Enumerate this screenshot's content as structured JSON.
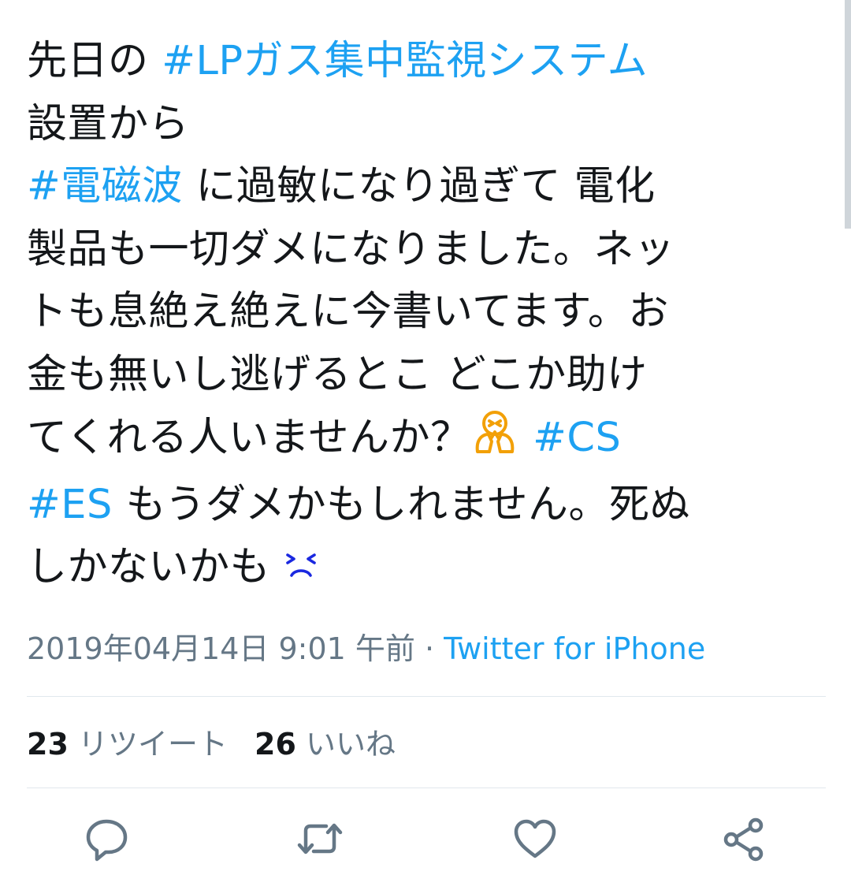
{
  "tweet": {
    "lines": [
      [
        {
          "t": "先日の "
        },
        {
          "t": "#LPガス集中監視システム",
          "tag": true
        }
      ],
      [
        {
          "t": "設置から"
        }
      ],
      [
        {
          "t": "#電磁波",
          "tag": true
        },
        {
          "t": " に過敏になり過ぎて 電化"
        }
      ],
      [
        {
          "t": "製品も一切ダメになりました。ネッ"
        }
      ],
      [
        {
          "t": "トも息絶え絶えに今書いてます。お"
        }
      ],
      [
        {
          "t": "金も無いし逃げるとこ どこか助け"
        }
      ],
      [
        {
          "t": "てくれる人いませんか？"
        },
        {
          "emoji": "face-in-hands-emoji"
        },
        {
          "t": " "
        },
        {
          "t": "#CS",
          "tag": true
        }
      ],
      [
        {
          "t": "#ES",
          "tag": true
        },
        {
          "t": " もうダメかもしれません。死ぬ"
        }
      ],
      [
        {
          "t": "しかないかも "
        },
        {
          "emoji": "frowning-squint-emoji"
        }
      ]
    ]
  },
  "meta": {
    "timestamp": "2019年04月14日 9:01 午前",
    "separator": " · ",
    "source": "Twitter for iPhone"
  },
  "stats": {
    "retweet_count": "23",
    "retweet_label": "リツイート",
    "like_count": "26",
    "like_label": "いいね"
  },
  "actions": {
    "reply_icon": "reply-icon",
    "retweet_icon": "retweet-icon",
    "like_icon": "like-icon",
    "share_icon": "share-icon"
  },
  "colors": {
    "text": "#14171a",
    "hashtag": "#1da1f2",
    "meta": "#657786",
    "divider": "#e1e8ed",
    "emoji_orange": "#f2a007",
    "emoji_blue": "#1a28e0"
  }
}
